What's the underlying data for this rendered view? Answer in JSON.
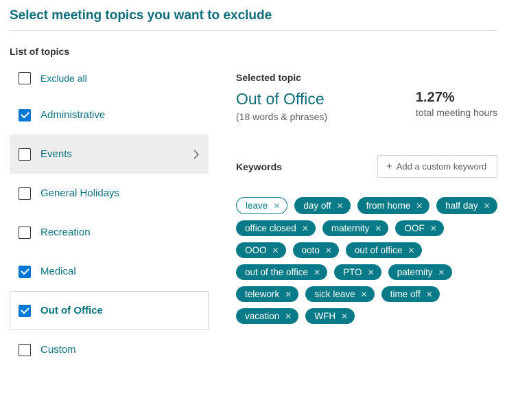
{
  "title": "Select meeting topics you want to exclude",
  "list_heading": "List of topics",
  "exclude_all_label": "Exclude all",
  "topics": [
    {
      "label": "Administrative",
      "checked": true,
      "hover": false,
      "selected": false
    },
    {
      "label": "Events",
      "checked": false,
      "hover": true,
      "selected": false
    },
    {
      "label": "General Holidays",
      "checked": false,
      "hover": false,
      "selected": false
    },
    {
      "label": "Recreation",
      "checked": false,
      "hover": false,
      "selected": false
    },
    {
      "label": "Medical",
      "checked": true,
      "hover": false,
      "selected": false
    },
    {
      "label": "Out of Office",
      "checked": true,
      "hover": false,
      "selected": true
    },
    {
      "label": "Custom",
      "checked": false,
      "hover": false,
      "selected": false
    }
  ],
  "detail": {
    "heading": "Selected topic",
    "name": "Out of Office",
    "subtitle": "(18 words & phrases)",
    "stat_value": "1.27%",
    "stat_label": "total meeting hours",
    "keywords_heading": "Keywords",
    "add_placeholder": "Add a custom keyword",
    "keywords": [
      {
        "text": "leave",
        "style": "outline"
      },
      {
        "text": "day off",
        "style": "filled"
      },
      {
        "text": "from home",
        "style": "filled"
      },
      {
        "text": "half day",
        "style": "filled"
      },
      {
        "text": "office closed",
        "style": "filled"
      },
      {
        "text": "maternity",
        "style": "filled"
      },
      {
        "text": "OOF",
        "style": "filled"
      },
      {
        "text": "OOO",
        "style": "filled"
      },
      {
        "text": "ooto",
        "style": "filled"
      },
      {
        "text": "out of office",
        "style": "filled"
      },
      {
        "text": "out of the office",
        "style": "filled"
      },
      {
        "text": "PTO",
        "style": "filled"
      },
      {
        "text": "paternity",
        "style": "filled"
      },
      {
        "text": "telework",
        "style": "filled"
      },
      {
        "text": "sick leave",
        "style": "filled"
      },
      {
        "text": "time off",
        "style": "filled"
      },
      {
        "text": "vacation",
        "style": "filled"
      },
      {
        "text": "WFH",
        "style": "filled"
      }
    ]
  }
}
